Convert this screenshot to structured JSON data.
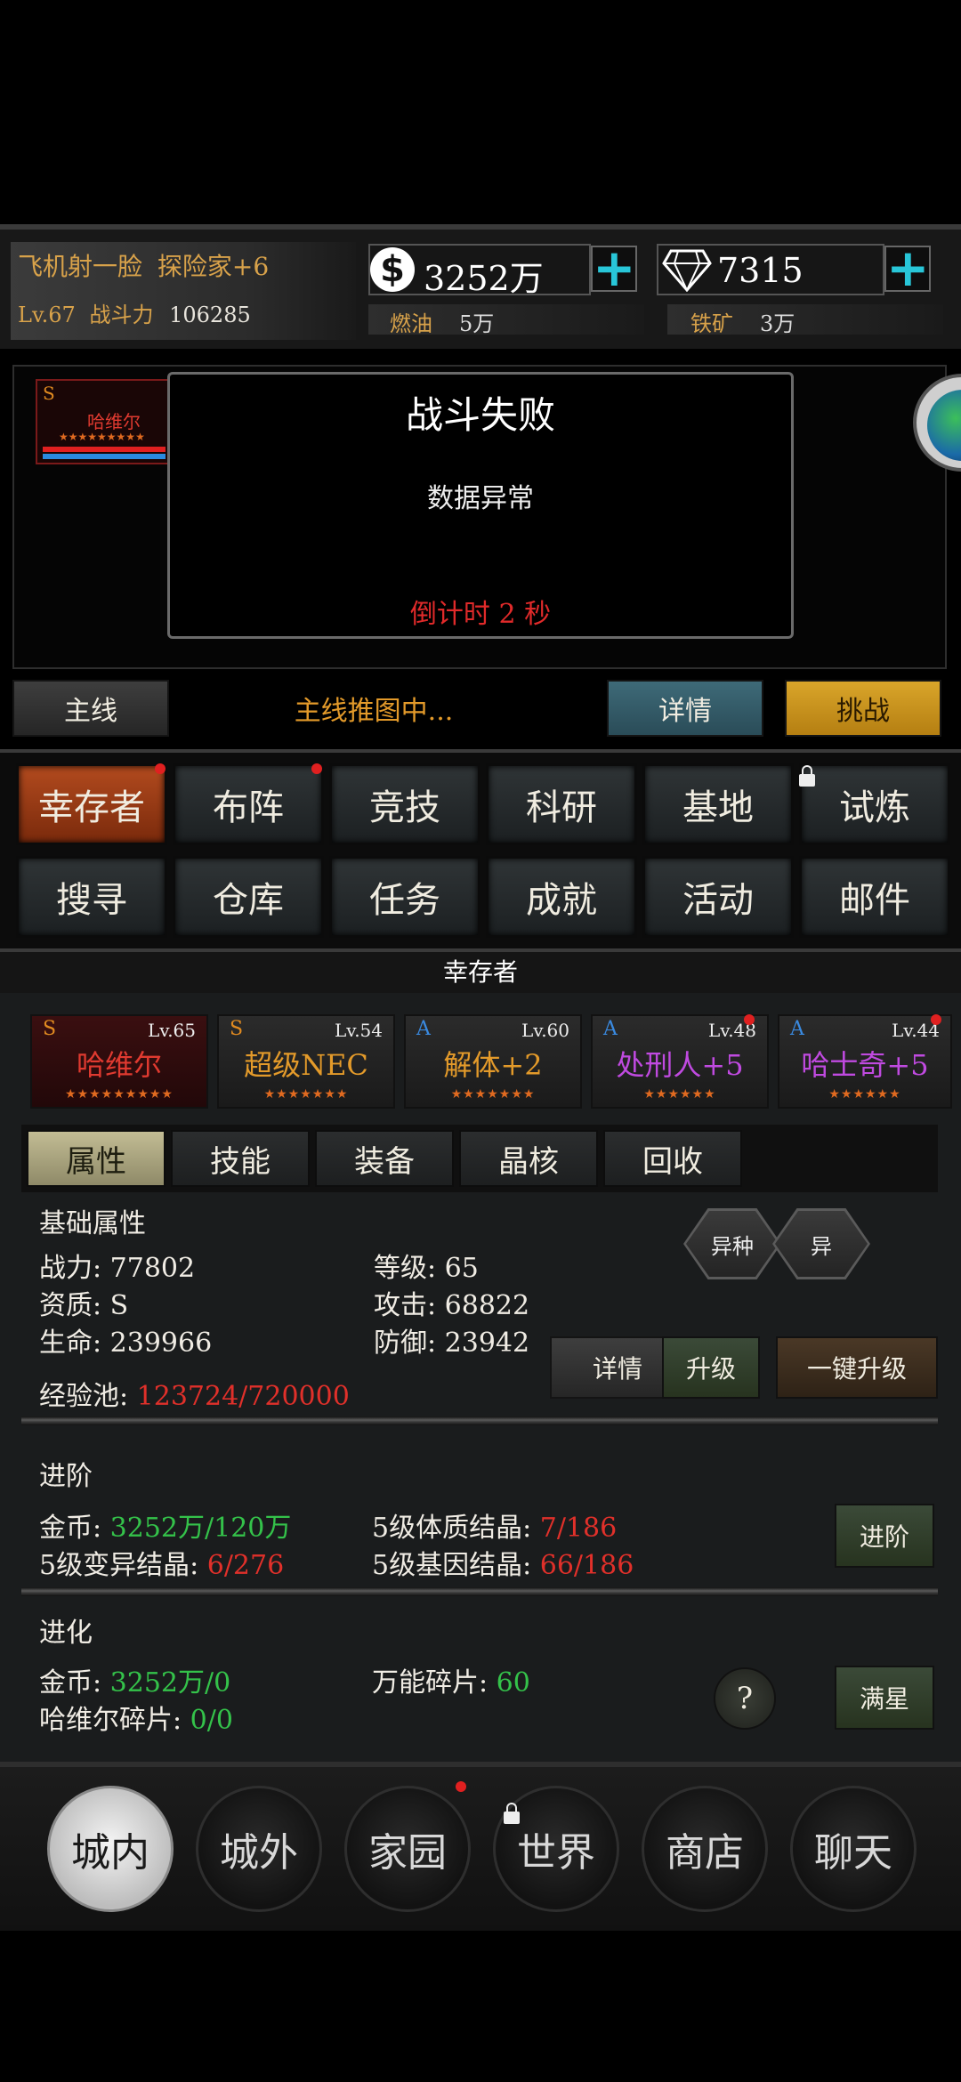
{
  "player": {
    "name": "飞机射一脸",
    "title": "探险家+6",
    "level": "Lv.67",
    "power_label": "战斗力",
    "power": "106285"
  },
  "resources": {
    "coins": "3252万",
    "gems": "7315",
    "fuel_label": "燃油",
    "fuel": "5万",
    "iron_label": "铁矿",
    "iron": "3万"
  },
  "battle": {
    "hero_grade": "S",
    "hero_name": "哈维尔",
    "hero_stars": "★★★★★★★★★",
    "title": "战斗失败",
    "message": "数据异常",
    "countdown": "倒计时 2 秒"
  },
  "mainline": {
    "label": "主线",
    "status": "主线推图中...",
    "details": "详情",
    "challenge": "挑战"
  },
  "menu": {
    "row1": [
      "幸存者",
      "布阵",
      "竞技",
      "科研",
      "基地",
      "试炼"
    ],
    "row2": [
      "搜寻",
      "仓库",
      "任务",
      "成就",
      "活动",
      "邮件"
    ]
  },
  "section_title": "幸存者",
  "survivors": [
    {
      "grade": "S",
      "level": "Lv.65",
      "name": "哈维尔",
      "stars": "★★★★★★★★★",
      "name_color": "#e03a30",
      "grade_color": "#e08a20"
    },
    {
      "grade": "S",
      "level": "Lv.54",
      "name": "超级NEC",
      "stars": "★★★★★★★",
      "name_color": "#e39a2a",
      "grade_color": "#e08a20"
    },
    {
      "grade": "A",
      "level": "Lv.60",
      "name": "解体+2",
      "stars": "★★★★★★★",
      "name_color": "#e39a2a",
      "grade_color": "#3a8ae0"
    },
    {
      "grade": "A",
      "level": "Lv.48",
      "name": "处刑人+5",
      "stars": "★★★★★★",
      "name_color": "#c04ae0",
      "grade_color": "#3a8ae0"
    },
    {
      "grade": "A",
      "level": "Lv.44",
      "name": "哈士奇+5",
      "stars": "★★★★★★",
      "name_color": "#c04ae0",
      "grade_color": "#3a8ae0"
    }
  ],
  "tabs": [
    "属性",
    "技能",
    "装备",
    "晶核",
    "回收"
  ],
  "attributes": {
    "heading": "基础属性",
    "power": "战力: 77802",
    "level": "等级: 65",
    "aptitude": "资质: S",
    "attack": "攻击: 68822",
    "hp": "生命: 239966",
    "defense": "防御: 23942",
    "exp_label": "经验池: ",
    "exp_value": "123724/720000",
    "hex1": "异种",
    "hex2": "异",
    "details_btn": "详情",
    "upgrade_btn": "升级",
    "oneclick_btn": "一键升级"
  },
  "advance": {
    "heading": "进阶",
    "gold_label": "金币: ",
    "gold_value": "3252万/120万",
    "physique_label": "5级体质结晶: ",
    "physique_value": "7/186",
    "mutation_label": "5级变异结晶: ",
    "mutation_value": "6/276",
    "gene_label": "5级基因结晶: ",
    "gene_value": "66/186",
    "button": "进阶"
  },
  "evolve": {
    "heading": "进化",
    "gold_label": "金币: ",
    "gold_value": "3252万/0",
    "universal_label": "万能碎片: ",
    "universal_value": "60",
    "frag_label": "哈维尔碎片: ",
    "frag_value": "0/0",
    "help": "?",
    "button": "满星"
  },
  "bottom_nav": [
    "城内",
    "城外",
    "家园",
    "世界",
    "商店",
    "聊天"
  ]
}
